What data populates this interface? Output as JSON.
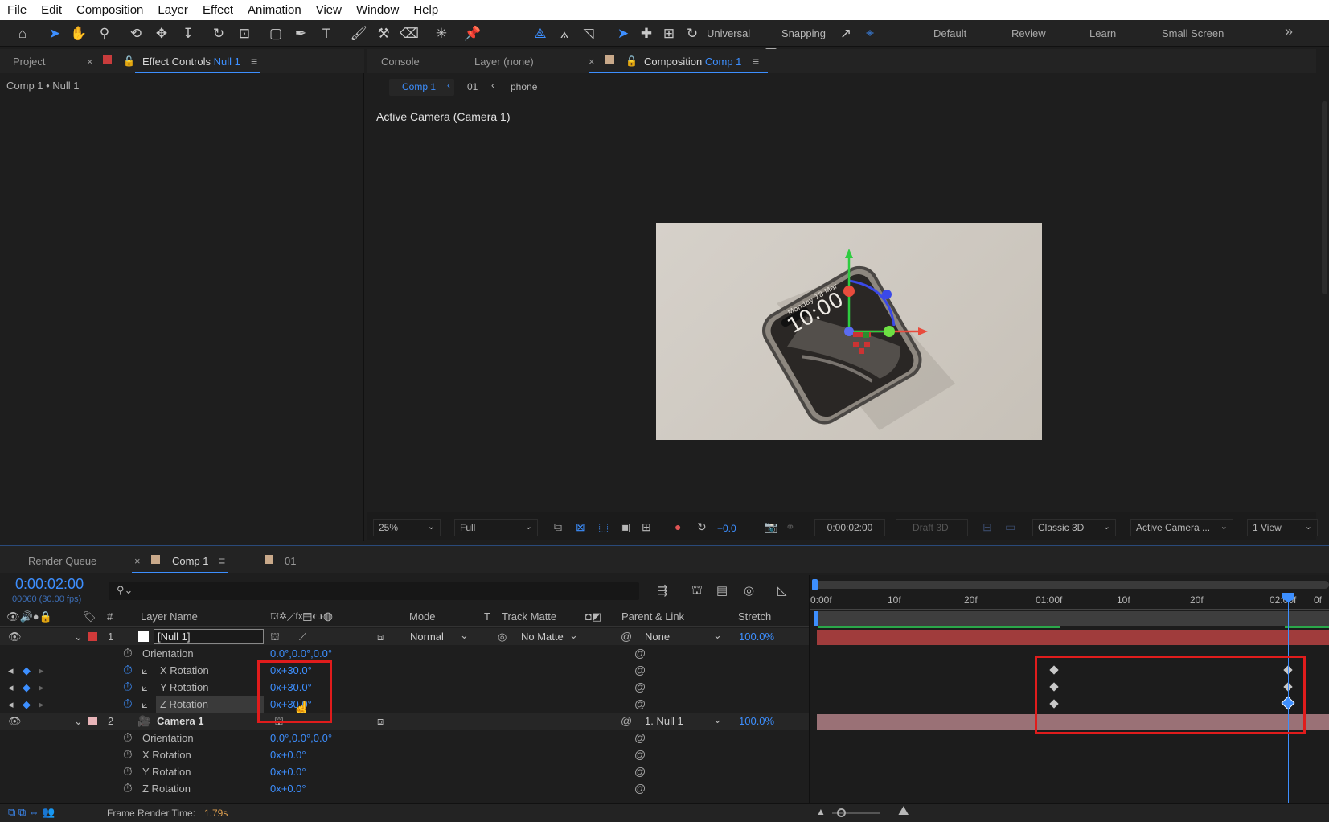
{
  "menu": [
    "File",
    "Edit",
    "Composition",
    "Layer",
    "Effect",
    "Animation",
    "View",
    "Window",
    "Help"
  ],
  "toolbar": {
    "universal_label": "Universal",
    "snapping_label": "Snapping",
    "workspaces": [
      "Default",
      "Review",
      "Learn",
      "Small Screen"
    ],
    "more_icon": "double-chevron-right-icon"
  },
  "left_panel": {
    "tab_project": "Project",
    "tab_effect_controls": "Effect Controls",
    "effect_controls_target": "Null 1",
    "breadcrumb": "Comp 1 • Null 1"
  },
  "comp_panel": {
    "tab_console": "Console",
    "tab_layer": "Layer (none)",
    "tab_composition": "Composition",
    "composition_name": "Comp 1",
    "flow": [
      "Comp 1",
      "01",
      "phone"
    ],
    "camera_label": "Active Camera (Camera 1)",
    "phone_time": "10:00",
    "phone_date": "Monday 18 Mar",
    "footer": {
      "zoom": "25%",
      "resolution": "Full",
      "exposure": "+0.0",
      "timecode": "0:00:02:00",
      "draft3d": "Draft 3D",
      "renderer": "Classic 3D",
      "view": "Active Camera ...",
      "views_count": "1 View"
    }
  },
  "timeline": {
    "tab_render_queue": "Render Queue",
    "tab_comp": "Comp 1",
    "tab_01": "01",
    "timecode": "0:00:02:00",
    "frames_fps": "00060 (30.00 fps)",
    "search_placeholder": "",
    "headers": {
      "num": "#",
      "layer_name": "Layer Name",
      "mode": "Mode",
      "t": "T",
      "track_matte": "Track Matte",
      "parent_link": "Parent & Link",
      "stretch": "Stretch"
    },
    "ruler": [
      "0:00f",
      "10f",
      "20f",
      "01:00f",
      "10f",
      "20f",
      "02:00f",
      "0f"
    ],
    "layers": [
      {
        "number": "1",
        "name": "[Null 1]",
        "color": "#d03a3a",
        "mode": "Normal",
        "track_matte": "No Matte",
        "parent": "None",
        "stretch": "100.0%",
        "props": [
          {
            "name": "Orientation",
            "value": "0.0°,0.0°,0.0°",
            "keyed": false
          },
          {
            "name": "X Rotation",
            "value": "0x+30.0°",
            "keyed": true
          },
          {
            "name": "Y Rotation",
            "value": "0x+30.0°",
            "keyed": true
          },
          {
            "name": "Z Rotation",
            "value": "0x+30.0°",
            "keyed": true
          }
        ]
      },
      {
        "number": "2",
        "name": "Camera 1",
        "color": "#e8b4b8",
        "parent": "1. Null 1",
        "stretch": "100.0%",
        "props": [
          {
            "name": "Orientation",
            "value": "0.0°,0.0°,0.0°",
            "keyed": false
          },
          {
            "name": "X Rotation",
            "value": "0x+0.0°",
            "keyed": false
          },
          {
            "name": "Y Rotation",
            "value": "0x+0.0°",
            "keyed": false
          },
          {
            "name": "Z Rotation",
            "value": "0x+0.0°",
            "keyed": false
          }
        ]
      }
    ],
    "frame_render_label": "Frame Render Time:",
    "frame_render_value": "1.79s"
  },
  "colors": {
    "accent": "#3d8fff",
    "highlight_box": "#e01c1c",
    "null_bar": "#a03c3c",
    "camera_bar": "#9a7176",
    "work_area": "#2aa84a"
  }
}
